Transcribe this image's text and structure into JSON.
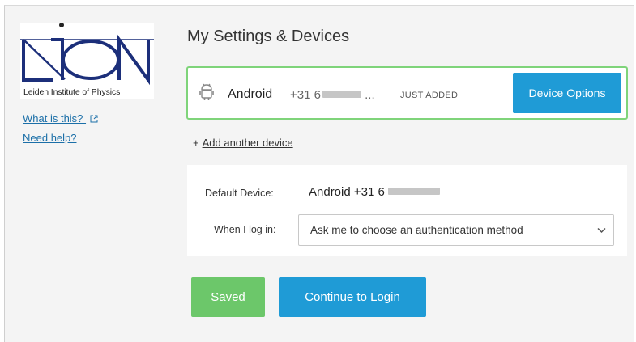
{
  "sidebar": {
    "logo": {
      "wordmark": "LION",
      "caption": "Leiden Institute of Physics"
    },
    "links": {
      "what_is_this": "What is this?",
      "need_help": "Need help?"
    }
  },
  "main": {
    "title": "My Settings & Devices",
    "device": {
      "name": "Android",
      "number_prefix": "+31 6",
      "number_suffix": "...",
      "status": "JUST ADDED",
      "options_label": "Device Options"
    },
    "add_device": {
      "plus": "+",
      "label": "Add another device"
    },
    "settings": {
      "default_device_label": "Default Device:",
      "default_device_value": "Android +31 6",
      "login_label": "When I log in:",
      "login_selected": "Ask me to choose an authentication method"
    },
    "buttons": {
      "saved": "Saved",
      "continue": "Continue to Login"
    }
  },
  "colors": {
    "accent_blue": "#1f9bd6",
    "success_green": "#6cc76a",
    "card_border_green": "#7fd47a",
    "logo_navy": "#1c2f7a",
    "link_blue": "#1b6fa8"
  },
  "icons": {
    "device": "android-icon",
    "external_link": "external-link-icon",
    "select": "chevron-down-icon"
  }
}
